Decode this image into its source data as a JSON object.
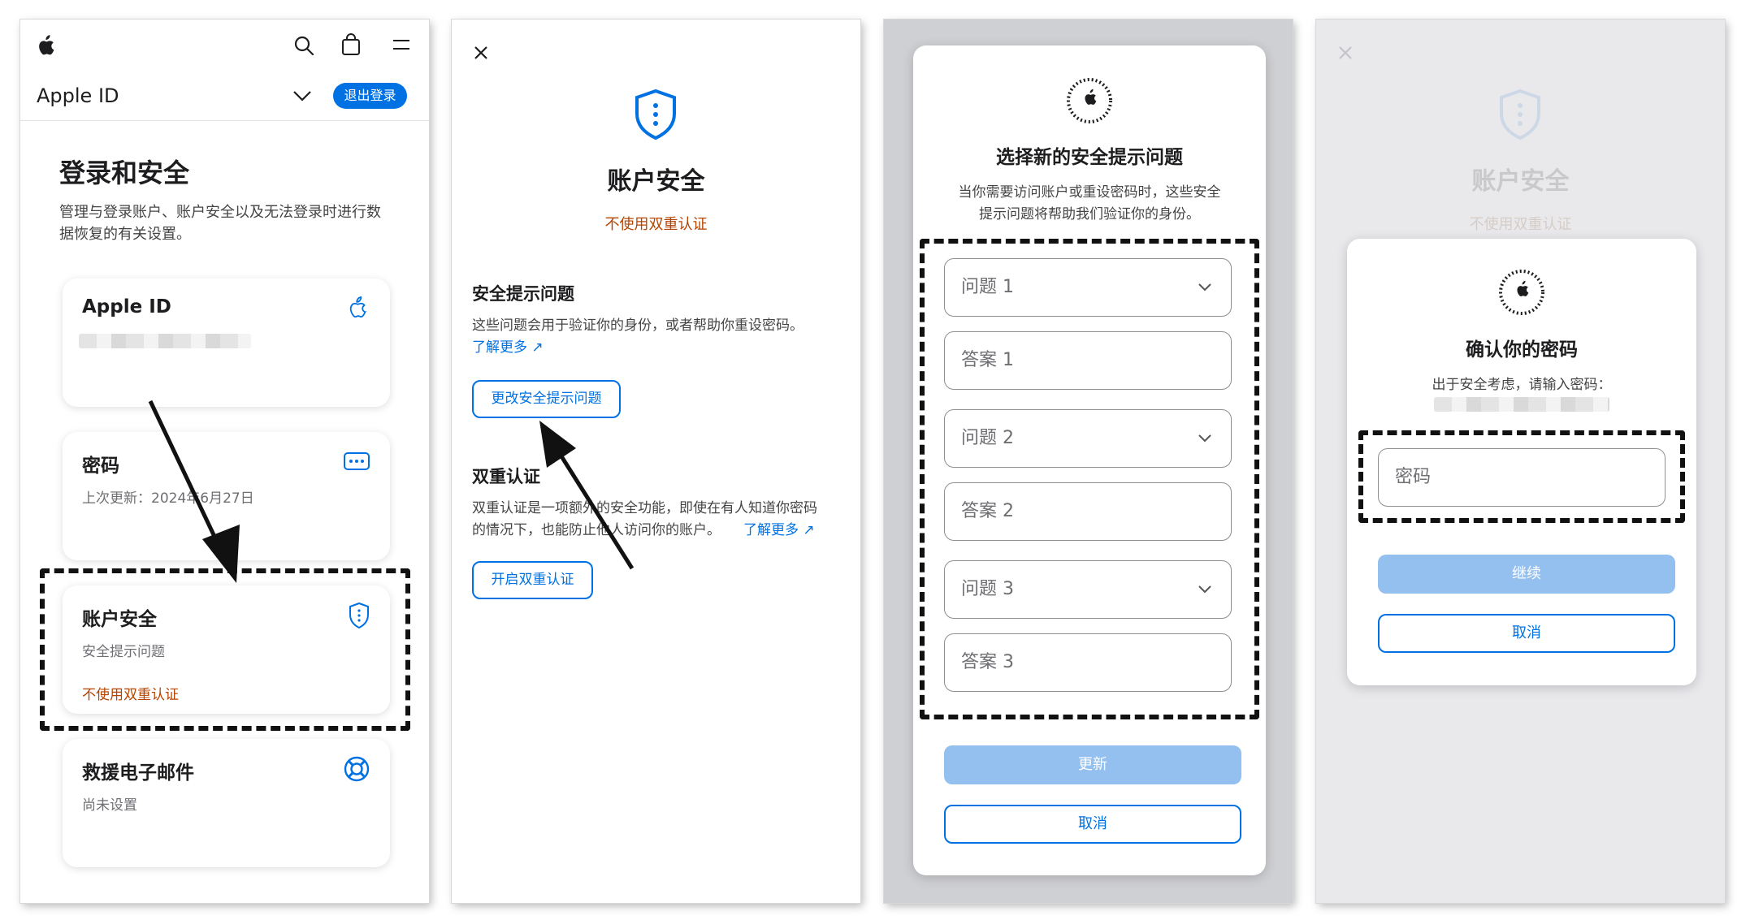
{
  "panel1": {
    "header": {
      "section": "Apple ID",
      "signout": "退出登录"
    },
    "title": "登录和安全",
    "description_line1": "管理与登录账户、账户安全以及无法登录时进行数",
    "description_line2": "据恢复的有关设置。",
    "cards": {
      "appleid": {
        "title": "Apple ID"
      },
      "password": {
        "title": "密码",
        "sub": "上次更新：2024年6月27日"
      },
      "security": {
        "title": "账户安全",
        "sub": "安全提示问题",
        "status": "不使用双重认证"
      },
      "rescue": {
        "title": "救援电子邮件",
        "sub": "尚未设置"
      }
    }
  },
  "panel2": {
    "title": "账户安全",
    "status": "不使用双重认证",
    "questions": {
      "heading": "安全提示问题",
      "desc": "这些问题会用于验证你的身份，或者帮助你重设密码。",
      "learn_more": "了解更多 ↗",
      "button": "更改安全提示问题"
    },
    "twofa": {
      "heading": "双重认证",
      "desc_line1": "双重认证是一项额外的安全功能，即使在有人知道你密码",
      "desc_line2": "的情况下，也能防止他人访问你的账户。",
      "learn_more": "了解更多 ↗",
      "button": "开启双重认证"
    }
  },
  "panel3": {
    "title": "选择新的安全提示问题",
    "desc_line1": "当你需要访问账户或重设密码时，这些安全",
    "desc_line2": "提示问题将帮助我们验证你的身份。",
    "fields": [
      "问题 1",
      "答案 1",
      "问题 2",
      "答案 2",
      "问题 3",
      "答案 3"
    ],
    "update": "更新",
    "cancel": "取消"
  },
  "panel4": {
    "bg_title": "账户安全",
    "bg_status": "不使用双重认证",
    "title": "确认你的密码",
    "desc": "出于安全考虑，请输入密码：",
    "password_placeholder": "密码",
    "continue": "继续",
    "cancel": "取消"
  },
  "colors": {
    "accent": "#0071e3",
    "warning": "#b64400",
    "disabled_button": "#93c0ee"
  },
  "icons": [
    "apple-logo-icon",
    "search-icon",
    "bag-icon",
    "menu-icon",
    "chevron-down-icon",
    "shield-icon",
    "password-dots-icon",
    "lifebuoy-icon",
    "close-icon",
    "arrow-annotation-icon"
  ]
}
